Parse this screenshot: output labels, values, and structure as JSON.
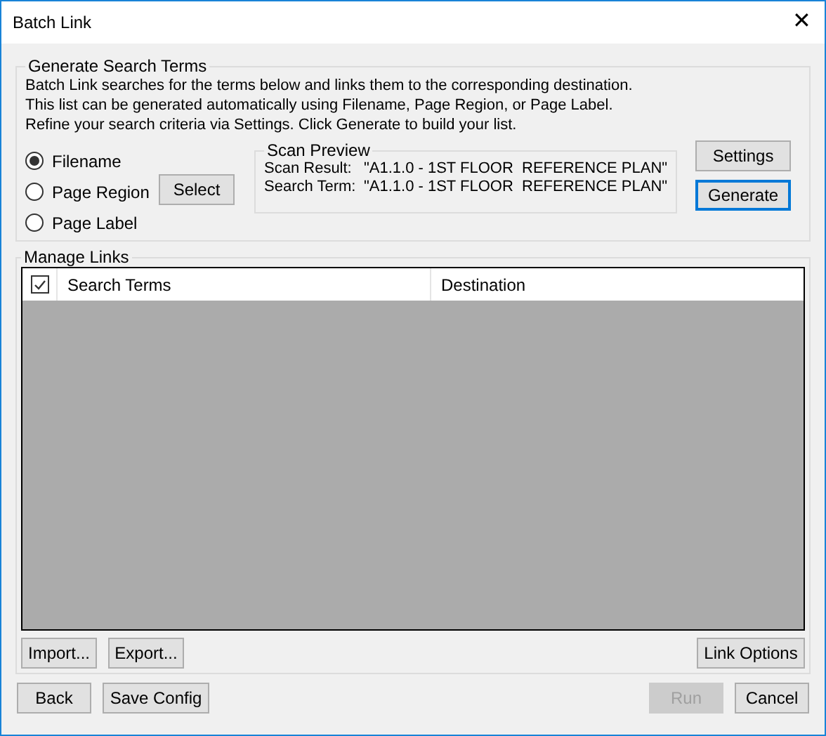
{
  "window": {
    "title": "Batch Link",
    "close": "✕"
  },
  "generate": {
    "title": "Generate Search Terms",
    "description": [
      "Batch Link searches for the terms below and links them to the corresponding destination.",
      "This list can be generated automatically using Filename, Page Region, or Page Label.",
      "Refine your search criteria via Settings. Click Generate to build your list."
    ],
    "sources": [
      {
        "label": "Filename",
        "selected": true
      },
      {
        "label": "Page Region",
        "selected": false
      },
      {
        "label": "Page Label",
        "selected": false
      }
    ],
    "select_button": {
      "label": "Select",
      "disabled": false,
      "focused": false
    },
    "preview": {
      "title": "Scan Preview",
      "rows": [
        {
          "label": "Scan Result:",
          "value": "\"A1.1.0 - 1ST FLOOR  REFERENCE PLAN\""
        },
        {
          "label": "Search Term:",
          "value": "\"A1.1.0 - 1ST FLOOR  REFERENCE PLAN\""
        }
      ]
    },
    "buttons": [
      {
        "label": "Settings",
        "disabled": false,
        "focused": false
      },
      {
        "label": "Generate",
        "disabled": false,
        "focused": true
      }
    ]
  },
  "links": {
    "title": "Manage Links",
    "select_all_checked": true,
    "columns": [
      "Search Terms",
      "Destination"
    ],
    "buttons_left": [
      {
        "label": "Import...",
        "disabled": false,
        "focused": false
      },
      {
        "label": "Export...",
        "disabled": false,
        "focused": false
      }
    ],
    "buttons_right": [
      {
        "label": "Link Options",
        "disabled": false,
        "focused": false
      }
    ]
  },
  "footer": {
    "left": [
      {
        "label": "Back",
        "disabled": false,
        "focused": false
      },
      {
        "label": "Save Config",
        "disabled": false,
        "focused": false
      }
    ],
    "right": [
      {
        "label": "Run",
        "disabled": true,
        "focused": false
      },
      {
        "label": "Cancel",
        "disabled": false,
        "focused": false
      }
    ]
  }
}
